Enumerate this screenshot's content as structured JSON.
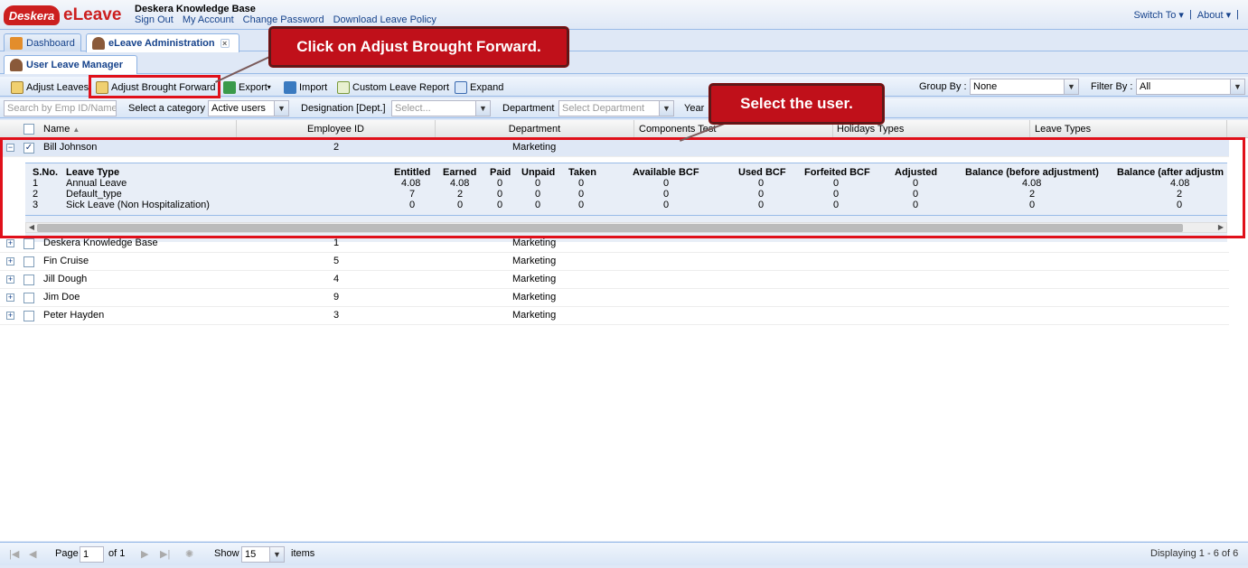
{
  "header": {
    "logo_text": "Deskera",
    "app_name": "eLeave",
    "company": "Deskera Knowledge Base",
    "links": [
      "Sign Out",
      "My Account",
      "Change Password",
      "Download Leave Policy"
    ],
    "switch_to": "Switch To",
    "about": "About",
    "sep": "|"
  },
  "tabs": {
    "dashboard": "Dashboard",
    "admin": "eLeave Administration",
    "sub": "User Leave Manager"
  },
  "toolbar": {
    "adjust_leaves": "Adjust Leaves",
    "adjust_bf": "Adjust Brought Forward",
    "export": "Export",
    "import": "Import",
    "custom_report": "Custom Leave Report",
    "expand": "Expand",
    "group_by_label": "Group By :",
    "group_by_value": "None",
    "filter_by_label": "Filter By :",
    "filter_by_value": "All"
  },
  "filters": {
    "search_placeholder": "Search by Emp ID/Name",
    "category_label": "Select a category",
    "category_value": "Active users",
    "designation_label": "Designation [Dept.]",
    "designation_placeholder": "Select...",
    "department_label": "Department",
    "department_placeholder": "Select Department",
    "year_label": "Year"
  },
  "grid": {
    "columns": [
      "Name",
      "Employee ID",
      "Department",
      "Components Test",
      "Holidays Types",
      "Leave Types"
    ],
    "expanded_row": {
      "name": "Bill Johnson",
      "id": "2",
      "dept": "Marketing"
    },
    "detail_headers": [
      "S.No.",
      "Leave Type",
      "Entitled",
      "Earned",
      "Paid",
      "Unpaid",
      "Taken",
      "Available BCF",
      "Used BCF",
      "Forfeited BCF",
      "Adjusted",
      "Balance (before adjustment)",
      "Balance (after adjustm"
    ],
    "detail_rows": [
      [
        "1",
        "Annual Leave",
        "4.08",
        "4.08",
        "0",
        "0",
        "0",
        "0",
        "0",
        "0",
        "0",
        "4.08",
        "4.08"
      ],
      [
        "2",
        "Default_type",
        "7",
        "2",
        "0",
        "0",
        "0",
        "0",
        "0",
        "0",
        "0",
        "2",
        "2"
      ],
      [
        "3",
        "Sick Leave (Non Hospitalization)",
        "0",
        "0",
        "0",
        "0",
        "0",
        "0",
        "0",
        "0",
        "0",
        "0",
        "0"
      ]
    ],
    "rows": [
      {
        "name": "Deskera Knowledge Base",
        "id": "1",
        "dept": "Marketing"
      },
      {
        "name": "Fin Cruise",
        "id": "5",
        "dept": "Marketing"
      },
      {
        "name": "Jill Dough",
        "id": "4",
        "dept": "Marketing"
      },
      {
        "name": "Jim Doe",
        "id": "9",
        "dept": "Marketing"
      },
      {
        "name": "Peter Hayden",
        "id": "3",
        "dept": "Marketing"
      }
    ]
  },
  "pager": {
    "page_label": "Page",
    "page_value": "1",
    "of_label": "of 1",
    "show_label": "Show",
    "show_value": "15",
    "items_label": "items",
    "display": "Displaying 1 - 6 of 6"
  },
  "callouts": {
    "adjust_bf": "Click on Adjust Brought Forward.",
    "select_user": "Select the user."
  }
}
